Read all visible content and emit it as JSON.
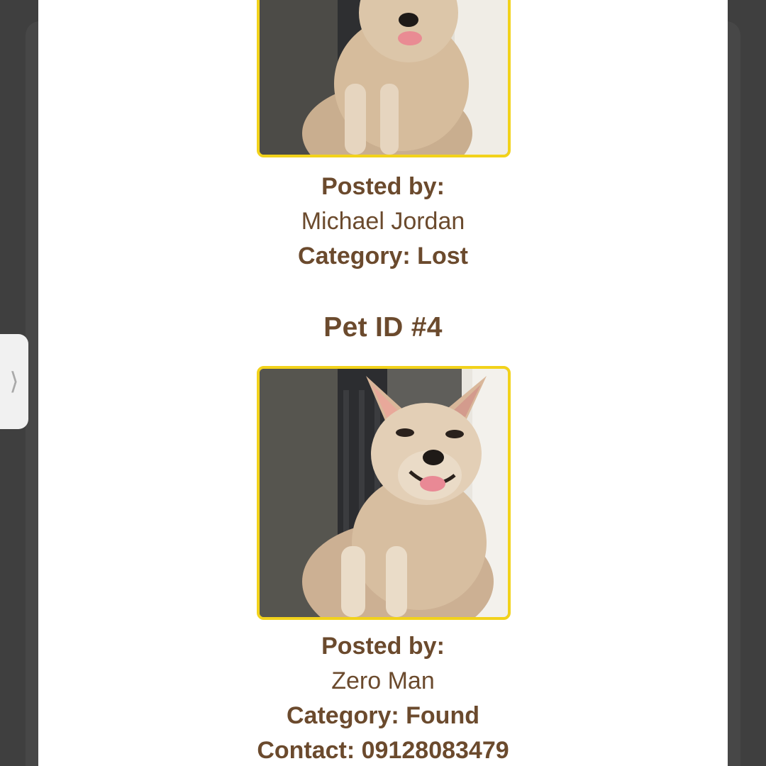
{
  "posts": [
    {
      "id_title": "",
      "photo_icon": "dog-photo",
      "posted_by_label": "Posted by:",
      "poster_name": "Michael Jordan",
      "category_line": "Category: Lost"
    },
    {
      "id_title": "Pet ID #4",
      "photo_icon": "dog-photo",
      "posted_by_label": "Posted by:",
      "poster_name": "Zero Man",
      "category_line": "Category: Found",
      "contact_line": "Contact: 09128083479"
    }
  ],
  "side_handle": {
    "icon": "chevron-right-icon",
    "glyph": "⟩"
  },
  "colors": {
    "text": "#6b4a2d",
    "photo_border": "#f2d21b",
    "background_dark": "#3f3f3f",
    "card": "#ffffff"
  }
}
